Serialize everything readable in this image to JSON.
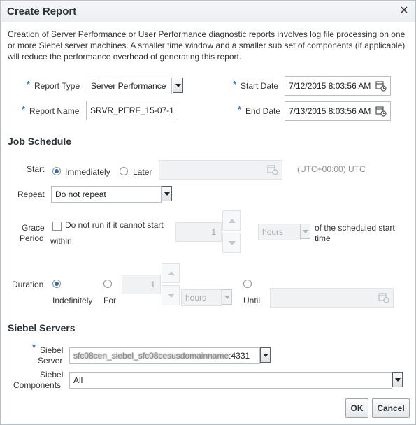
{
  "dialog": {
    "title": "Create Report",
    "close_label": "✕",
    "description": "Creation of Server Performance or User Performance diagnostic reports involves log file processing on one or more Siebel server machines. A smaller time window and a smaller sub set of components (if applicable) will reduce the performance overhead of generating this report."
  },
  "report": {
    "required_marker": "*",
    "type_label": "Report Type",
    "type_value": "Server Performance",
    "name_label": "Report Name",
    "name_value": "SRVR_PERF_15-07-1",
    "start_date_label": "Start Date",
    "start_date_value": "7/12/2015 8:03:56 AM",
    "end_date_label": "End Date",
    "end_date_value": "7/13/2015 8:03:56 AM"
  },
  "job_schedule": {
    "heading": "Job Schedule",
    "start_label": "Start",
    "immediately_label": "Immediately",
    "later_label": "Later",
    "timezone_label": "(UTC+00:00) UTC",
    "repeat_label": "Repeat",
    "repeat_value": "Do not repeat",
    "grace_label_line1": "Grace",
    "grace_label_line2": "Period",
    "grace_checkbox_label": "Do not run if it cannot start",
    "grace_within_label": "within",
    "grace_value": "1",
    "grace_unit": "hours",
    "grace_suffix_line1": "of the scheduled start",
    "grace_suffix_line2": "time",
    "duration_label": "Duration",
    "indefinitely_label": "Indefinitely",
    "for_label": "For",
    "duration_value": "1",
    "duration_unit": "hours",
    "until_label": "Until"
  },
  "siebel": {
    "heading": "Siebel Servers",
    "server_label_line1": "Siebel",
    "server_label_line2": "Server",
    "server_value_visible": ":4331",
    "server_value_obscured": "sfc08cen_siebel_sfc08cesusdomainname",
    "components_label_line1": "Siebel",
    "components_label_line2": "Components",
    "components_value": "All"
  },
  "buttons": {
    "ok": "OK",
    "cancel": "Cancel"
  },
  "colors": {
    "required_star": "#2f78c4",
    "radio_selected": "#2a6db0"
  }
}
